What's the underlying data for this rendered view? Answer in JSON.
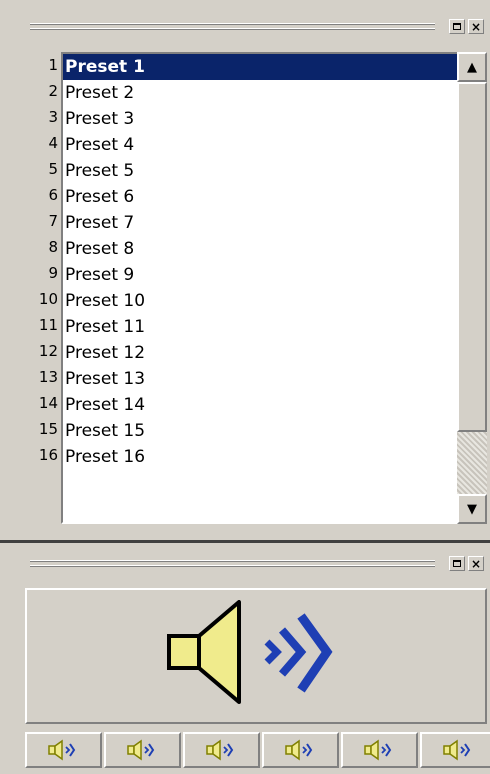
{
  "preset_panel": {
    "dock_buttons": {
      "maximize_icon": "maximize-icon",
      "close_label": "×"
    },
    "presets": [
      {
        "num": "1",
        "label": "Preset 1",
        "selected": true
      },
      {
        "num": "2",
        "label": "Preset 2"
      },
      {
        "num": "3",
        "label": "Preset 3"
      },
      {
        "num": "4",
        "label": "Preset 4"
      },
      {
        "num": "5",
        "label": "Preset 5"
      },
      {
        "num": "6",
        "label": "Preset 6"
      },
      {
        "num": "7",
        "label": "Preset 7"
      },
      {
        "num": "8",
        "label": "Preset 8"
      },
      {
        "num": "9",
        "label": "Preset 9"
      },
      {
        "num": "10",
        "label": "Preset 10"
      },
      {
        "num": "11",
        "label": "Preset 11"
      },
      {
        "num": "12",
        "label": "Preset 12"
      },
      {
        "num": "13",
        "label": "Preset 13"
      },
      {
        "num": "14",
        "label": "Preset 14"
      },
      {
        "num": "15",
        "label": "Preset 15"
      },
      {
        "num": "16",
        "label": "Preset 16"
      }
    ],
    "scrollbar": {
      "up_glyph": "▲",
      "down_glyph": "▼"
    }
  },
  "speaker_panel": {
    "dock_buttons": {
      "maximize_icon": "maximize-icon",
      "close_label": "×"
    },
    "main_icon": "speaker-volume-icon",
    "channel_icons": [
      "speaker-icon",
      "speaker-icon",
      "speaker-icon",
      "speaker-icon",
      "speaker-icon",
      "speaker-icon"
    ]
  },
  "colors": {
    "face": "#d4d0c8",
    "selection": "#0a246a",
    "speaker_fill": "#f0eb8c",
    "wave_blue": "#1e3fb4"
  }
}
